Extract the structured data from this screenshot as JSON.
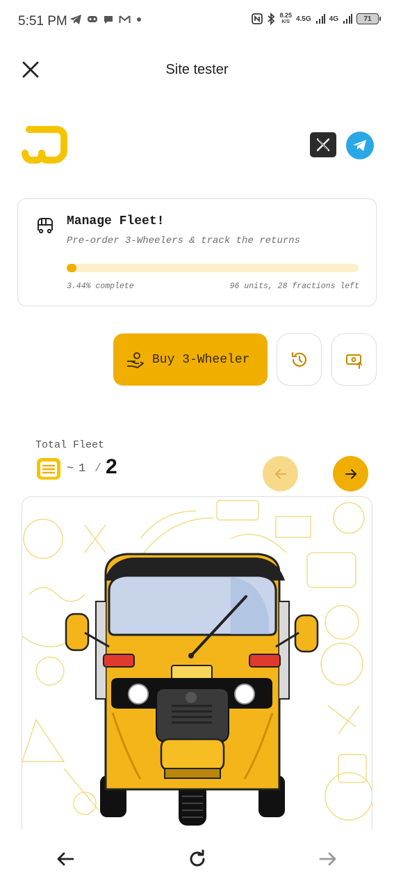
{
  "status_bar": {
    "time": "5:51 PM",
    "net_speed_value": "8.25",
    "net_speed_unit": "K/S",
    "net1": "4.5G",
    "net2": "4G",
    "battery": "71"
  },
  "header": {
    "title": "Site tester"
  },
  "card": {
    "title": "Manage Fleet!",
    "subtitle": "Pre-order 3-Wheelers & track the returns",
    "progress_percent": 3.44,
    "progress_text": "3.44% complete",
    "remaining_text": "96 units, 28 fractions left"
  },
  "actions": {
    "buy_label": "Buy 3-Wheeler"
  },
  "fleet": {
    "label": "Total Fleet",
    "tilde": "~",
    "current": "1",
    "separator": "/",
    "total": "2"
  },
  "colors": {
    "accent": "#f0ae00",
    "accent_light": "#f7d98a",
    "progress_track": "#fdefc8",
    "telegram": "#2aa7e6"
  }
}
